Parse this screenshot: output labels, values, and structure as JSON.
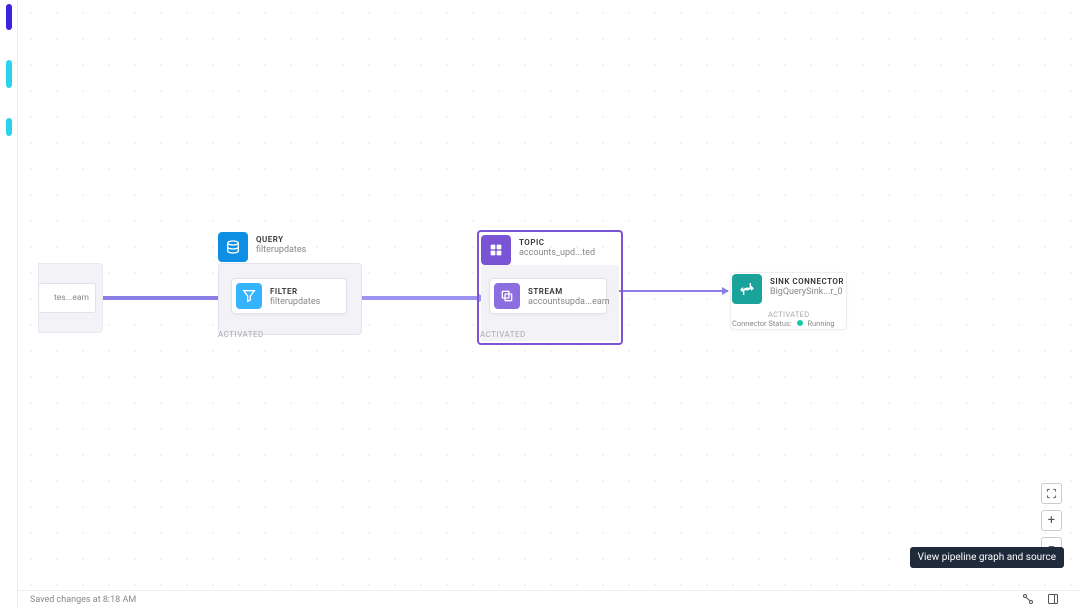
{
  "status_text": "Saved changes at 8:18 AM",
  "tooltip": "View pipeline graph and source",
  "partial": {
    "name": "tes...eam"
  },
  "query": {
    "header_type": "QUERY",
    "header_name": "filterupdates",
    "filter_type": "FILTER",
    "filter_name": "filterupdates",
    "activated": "ACTIVATED"
  },
  "topic": {
    "header_type": "TOPIC",
    "header_name": "accounts_upd...ted",
    "stream_type": "STREAM",
    "stream_name": "accountsupda...eam",
    "activated": "ACTIVATED"
  },
  "sink": {
    "type": "SINK CONNECTOR",
    "name": "BigQuerySink...r_0",
    "activated": "ACTIVATED",
    "status_label": "Connector Status:",
    "status_value": "Running"
  },
  "zoom": {
    "recenter": "⤢",
    "plus": "+",
    "minus": "−"
  }
}
